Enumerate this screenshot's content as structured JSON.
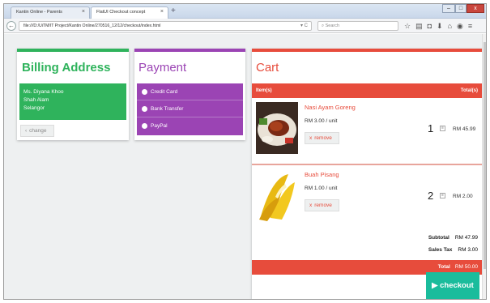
{
  "browser": {
    "tabs": [
      {
        "label": "Kantin Online - Parents"
      },
      {
        "label": "FlatUI Checkout concept"
      }
    ],
    "new_tab": "+",
    "url": "file:///D:/UiTM/IT Project/Kantin Online/270516_12/12/checkout/index.html",
    "search_placeholder": "Search",
    "window_buttons": {
      "minimize": "–",
      "maximize": "□",
      "close": "x"
    }
  },
  "billing": {
    "title": "Billing Address",
    "address_lines": [
      "Ms. Diyana Khoo",
      "Shah Alam",
      "Selangor"
    ],
    "change_label": "change",
    "change_icon": "‹"
  },
  "payment": {
    "title": "Payment",
    "options": [
      {
        "label": "Credit Card"
      },
      {
        "label": "Bank Transfer"
      },
      {
        "label": "PayPal"
      }
    ]
  },
  "cart": {
    "title": "Cart",
    "header": {
      "items": "Item(s)",
      "totals": "Total(s)"
    },
    "items": [
      {
        "name": "Nasi Ayam Goreng",
        "price": "RM 3.00 / unit",
        "remove": "remove",
        "remove_icon": "x",
        "qty": "1",
        "total": "RM 45.99"
      },
      {
        "name": "Buah Pisang",
        "price": "RM 1.00 / unit",
        "remove": "remove",
        "remove_icon": "x",
        "qty": "2",
        "total": "RM 2.00"
      }
    ],
    "subtotal": {
      "label": "Subtotal",
      "value": "RM 47.99"
    },
    "tax": {
      "label": "Sales Tax",
      "value": "RM 3.00"
    },
    "total": {
      "label": "Total",
      "value": "RM 50.00"
    },
    "checkout_label": "checkout",
    "checkout_icon": "▶"
  },
  "colors": {
    "billing_green": "#2fb35c",
    "payment_purple": "#9b44b4",
    "cart_red": "#e74c3c",
    "checkout_teal": "#1abc9c"
  }
}
